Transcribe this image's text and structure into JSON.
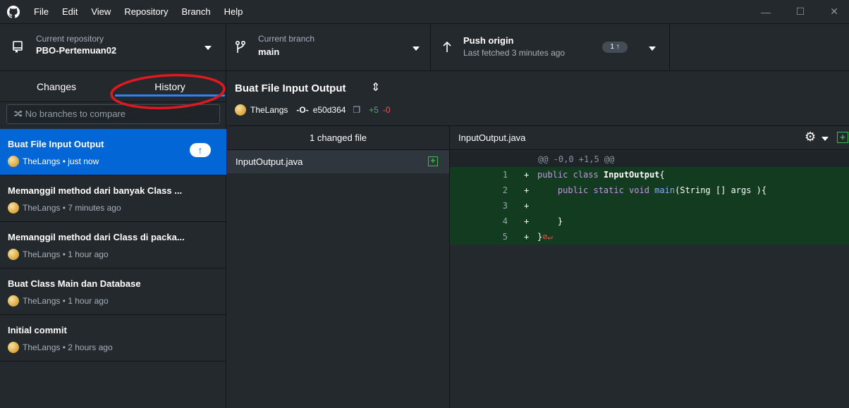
{
  "menu": [
    "File",
    "Edit",
    "View",
    "Repository",
    "Branch",
    "Help"
  ],
  "window_controls": {
    "minimize": "—",
    "maximize": "☐",
    "close": "✕"
  },
  "toolbar": {
    "repo_label": "Current repository",
    "repo_name": "PBO-Pertemuan02",
    "branch_label": "Current branch",
    "branch_name": "main",
    "push_title": "Push origin",
    "push_sub": "Last fetched 3 minutes ago",
    "push_badge": "1 ↑"
  },
  "tabs": {
    "changes": "Changes",
    "history": "History"
  },
  "compare_placeholder": "No branches to compare",
  "commits": [
    {
      "title": "Buat File Input Output",
      "meta": "TheLangs • just now",
      "selected": true
    },
    {
      "title": "Memanggil method dari banyak Class ...",
      "meta": "TheLangs • 7 minutes ago"
    },
    {
      "title": "Memanggil method dari Class di packa...",
      "meta": "TheLangs • 1 hour ago"
    },
    {
      "title": "Buat Class Main dan Database",
      "meta": "TheLangs • 1 hour ago"
    },
    {
      "title": "Initial commit",
      "meta": "TheLangs • 2 hours ago"
    }
  ],
  "commit_detail": {
    "title": "Buat File Input Output",
    "author": "TheLangs",
    "sha": "e50d364",
    "additions": "+5",
    "deletions": "-0"
  },
  "files": {
    "header": "1 changed file",
    "items": [
      "InputOutput.java"
    ]
  },
  "diff": {
    "filename": "InputOutput.java",
    "hunk": "@@ -0,0 +1,5 @@",
    "lines": [
      {
        "num": "1",
        "sign": "+",
        "pre": "public class ",
        "bold": "InputOutput",
        "post": "{"
      },
      {
        "num": "2",
        "sign": "+",
        "pre": "    public static void ",
        "bold": "main",
        "post": "(String [] args ){"
      },
      {
        "num": "3",
        "sign": "+",
        "pre": "",
        "bold": "",
        "post": ""
      },
      {
        "num": "4",
        "sign": "+",
        "pre": "    }",
        "bold": "",
        "post": ""
      },
      {
        "num": "5",
        "sign": "+",
        "pre": "}",
        "bold": "",
        "post": ""
      }
    ]
  },
  "colors": {
    "accent": "#2f81f7",
    "selected_row": "#0366d6",
    "annotation_red": "#e0191e",
    "diff_add_bg": "#133b1f",
    "add_green": "#3fb950",
    "del_red": "#f85149"
  }
}
